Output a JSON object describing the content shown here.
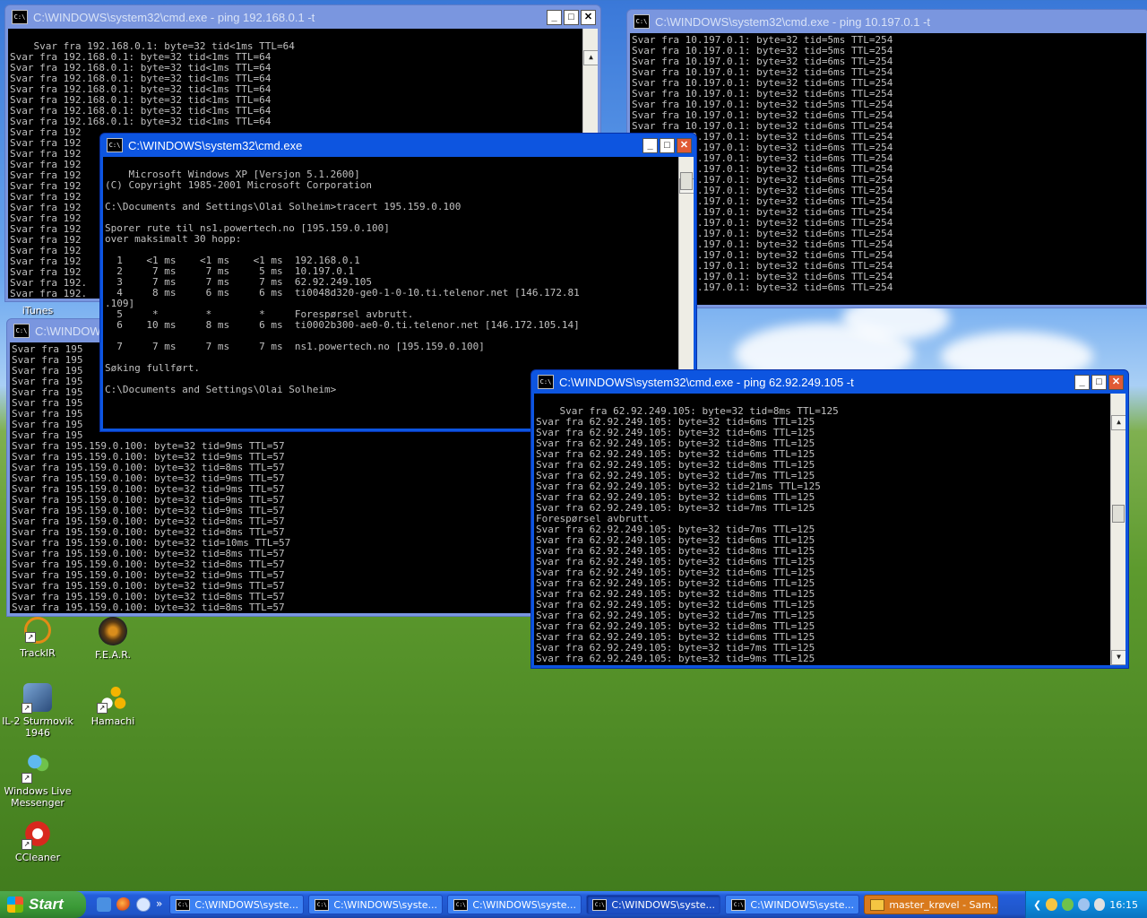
{
  "desktop": {
    "icons": [
      {
        "label": "iTunes"
      },
      {
        "label": "TrackIR"
      },
      {
        "label": "F.E.A.R."
      },
      {
        "label": "IL-2 Sturmovik 1946"
      },
      {
        "label": "Hamachi"
      },
      {
        "label": "Windows Live Messenger"
      },
      {
        "label": "CCleaner"
      }
    ]
  },
  "windows": {
    "w1": {
      "title": "C:\\WINDOWS\\system32\\cmd.exe - ping 192.168.0.1 -t",
      "text": "Svar fra 192.168.0.1: byte=32 tid<1ms TTL=64\nSvar fra 192.168.0.1: byte=32 tid<1ms TTL=64\nSvar fra 192.168.0.1: byte=32 tid<1ms TTL=64\nSvar fra 192.168.0.1: byte=32 tid<1ms TTL=64\nSvar fra 192.168.0.1: byte=32 tid<1ms TTL=64\nSvar fra 192.168.0.1: byte=32 tid<1ms TTL=64\nSvar fra 192.168.0.1: byte=32 tid<1ms TTL=64\nSvar fra 192.168.0.1: byte=32 tid<1ms TTL=64\nSvar fra 192\nSvar fra 192\nSvar fra 192\nSvar fra 192\nSvar fra 192\nSvar fra 192\nSvar fra 192\nSvar fra 192\nSvar fra 192\nSvar fra 192\nSvar fra 192\nSvar fra 192\nSvar fra 192\nSvar fra 192\nSvar fra 192.\nSvar fra 192."
    },
    "w2": {
      "title": "C:\\WINDOWS\\system32\\cmd.exe - ping 10.197.0.1 -t",
      "text": "Svar fra 10.197.0.1: byte=32 tid=5ms TTL=254\nSvar fra 10.197.0.1: byte=32 tid=5ms TTL=254\nSvar fra 10.197.0.1: byte=32 tid=6ms TTL=254\nSvar fra 10.197.0.1: byte=32 tid=6ms TTL=254\nSvar fra 10.197.0.1: byte=32 tid=6ms TTL=254\nSvar fra 10.197.0.1: byte=32 tid=6ms TTL=254\nSvar fra 10.197.0.1: byte=32 tid=5ms TTL=254\nSvar fra 10.197.0.1: byte=32 tid=6ms TTL=254\nSvar fra 10.197.0.1: byte=32 tid=6ms TTL=254\nSvar fra 10.197.0.1: byte=32 tid=6ms TTL=254\nSvar fra 10.197.0.1: byte=32 tid=6ms TTL=254\nSvar fra 10.197.0.1: byte=32 tid=6ms TTL=254\nSvar fra 10.197.0.1: byte=32 tid=6ms TTL=254\nSvar fra 10.197.0.1: byte=32 tid=6ms TTL=254\nSvar fra 10.197.0.1: byte=32 tid=6ms TTL=254\nSvar fra 10.197.0.1: byte=32 tid=6ms TTL=254\nSvar fra 10.197.0.1: byte=32 tid=6ms TTL=254\nSvar fra 10.197.0.1: byte=32 tid=6ms TTL=254\nSvar fra 10.197.0.1: byte=32 tid=6ms TTL=254\nSvar fra 10.197.0.1: byte=32 tid=6ms TTL=254\nSvar fra 10.197.0.1: byte=32 tid=6ms TTL=254\nSvar fra 10.197.0.1: byte=32 tid=6ms TTL=254\nSvar fra 10.197.0.1: byte=32 tid=6ms TTL=254\nSvar fra 10.197.0.1: byte=32 tid=6ms TTL=254"
    },
    "w3": {
      "title": "C:\\WINDOWS\\system32\\cmd.exe",
      "text": "Microsoft Windows XP [Versjon 5.1.2600]\n(C) Copyright 1985-2001 Microsoft Corporation\n\nC:\\Documents and Settings\\Olai Solheim>tracert 195.159.0.100\n\nSporer rute til ns1.powertech.no [195.159.0.100]\nover maksimalt 30 hopp:\n\n  1    <1 ms    <1 ms    <1 ms  192.168.0.1\n  2     7 ms     7 ms     5 ms  10.197.0.1\n  3     7 ms     7 ms     7 ms  62.92.249.105\n  4     8 ms     6 ms     6 ms  ti0048d320-ge0-1-0-10.ti.telenor.net [146.172.81\n.109]\n  5     *        *        *     Forespørsel avbrutt.\n  6    10 ms     8 ms     6 ms  ti0002b300-ae0-0.ti.telenor.net [146.172.105.14]\n\n  7     7 ms     7 ms     7 ms  ns1.powertech.no [195.159.0.100]\n\nSøking fullført.\n\nC:\\Documents and Settings\\Olai Solheim>"
    },
    "w4": {
      "title": "C:\\WINDOWS\\system32\\cmd.exe - ping 195.159.0.100 -t",
      "title_visible": "C:\\WINDOW",
      "text": "Svar fra 195\nSvar fra 195\nSvar fra 195\nSvar fra 195\nSvar fra 195\nSvar fra 195\nSvar fra 195\nSvar fra 195\nSvar fra 195\nSvar fra 195.159.0.100: byte=32 tid=9ms TTL=57\nSvar fra 195.159.0.100: byte=32 tid=9ms TTL=57\nSvar fra 195.159.0.100: byte=32 tid=8ms TTL=57\nSvar fra 195.159.0.100: byte=32 tid=9ms TTL=57\nSvar fra 195.159.0.100: byte=32 tid=9ms TTL=57\nSvar fra 195.159.0.100: byte=32 tid=9ms TTL=57\nSvar fra 195.159.0.100: byte=32 tid=9ms TTL=57\nSvar fra 195.159.0.100: byte=32 tid=8ms TTL=57\nSvar fra 195.159.0.100: byte=32 tid=8ms TTL=57\nSvar fra 195.159.0.100: byte=32 tid=10ms TTL=57\nSvar fra 195.159.0.100: byte=32 tid=8ms TTL=57\nSvar fra 195.159.0.100: byte=32 tid=8ms TTL=57\nSvar fra 195.159.0.100: byte=32 tid=9ms TTL=57\nSvar fra 195.159.0.100: byte=32 tid=9ms TTL=57\nSvar fra 195.159.0.100: byte=32 tid=8ms TTL=57\nSvar fra 195.159.0.100: byte=32 tid=8ms TTL=57"
    },
    "w5": {
      "title": "C:\\WINDOWS\\system32\\cmd.exe - ping 62.92.249.105 -t",
      "text": "Svar fra 62.92.249.105: byte=32 tid=8ms TTL=125\nSvar fra 62.92.249.105: byte=32 tid=6ms TTL=125\nSvar fra 62.92.249.105: byte=32 tid=6ms TTL=125\nSvar fra 62.92.249.105: byte=32 tid=8ms TTL=125\nSvar fra 62.92.249.105: byte=32 tid=6ms TTL=125\nSvar fra 62.92.249.105: byte=32 tid=8ms TTL=125\nSvar fra 62.92.249.105: byte=32 tid=7ms TTL=125\nSvar fra 62.92.249.105: byte=32 tid=21ms TTL=125\nSvar fra 62.92.249.105: byte=32 tid=6ms TTL=125\nSvar fra 62.92.249.105: byte=32 tid=7ms TTL=125\nForespørsel avbrutt.\nSvar fra 62.92.249.105: byte=32 tid=7ms TTL=125\nSvar fra 62.92.249.105: byte=32 tid=6ms TTL=125\nSvar fra 62.92.249.105: byte=32 tid=8ms TTL=125\nSvar fra 62.92.249.105: byte=32 tid=6ms TTL=125\nSvar fra 62.92.249.105: byte=32 tid=6ms TTL=125\nSvar fra 62.92.249.105: byte=32 tid=6ms TTL=125\nSvar fra 62.92.249.105: byte=32 tid=8ms TTL=125\nSvar fra 62.92.249.105: byte=32 tid=6ms TTL=125\nSvar fra 62.92.249.105: byte=32 tid=7ms TTL=125\nSvar fra 62.92.249.105: byte=32 tid=8ms TTL=125\nSvar fra 62.92.249.105: byte=32 tid=6ms TTL=125\nSvar fra 62.92.249.105: byte=32 tid=7ms TTL=125\nSvar fra 62.92.249.105: byte=32 tid=9ms TTL=125\nSvar fra 62.92.249.105: byte=32 tid=8ms TTL=125"
    },
    "buttons": {
      "minimize": "_",
      "maximize": "□",
      "close": "✕"
    },
    "scroll": {
      "up": "▲",
      "down": "▼"
    },
    "icon_text": "C:\\"
  },
  "taskbar": {
    "start_label": "Start",
    "more_label": "»",
    "items": [
      {
        "label": "C:\\WINDOWS\\syste..."
      },
      {
        "label": "C:\\WINDOWS\\syste..."
      },
      {
        "label": "C:\\WINDOWS\\syste..."
      },
      {
        "label": "C:\\WINDOWS\\syste..."
      },
      {
        "label": "C:\\WINDOWS\\syste..."
      },
      {
        "label": "master_krøvel - Sam..."
      }
    ],
    "clock": "16:15",
    "tray_expand": "❮"
  }
}
